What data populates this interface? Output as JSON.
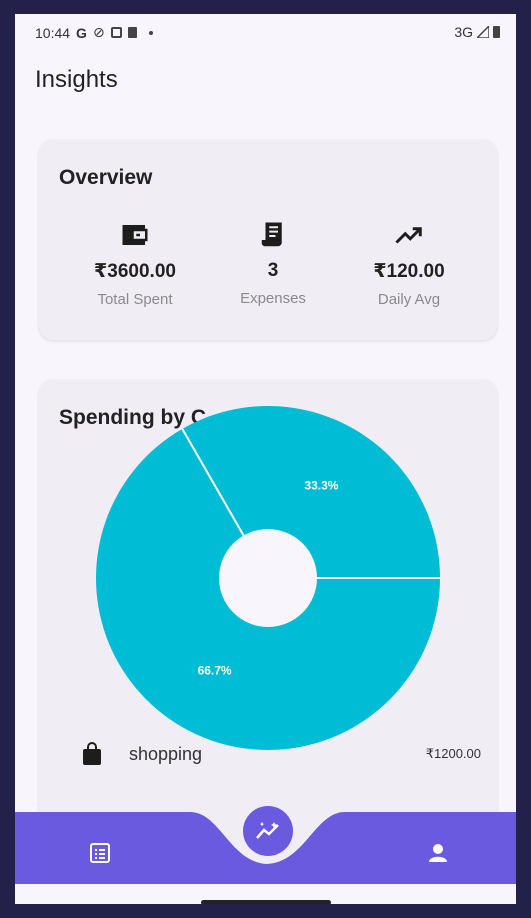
{
  "status": {
    "time": "10:44",
    "network": "3G"
  },
  "page_title": "Insights",
  "overview": {
    "title": "Overview",
    "stats": [
      {
        "icon": "wallet-icon",
        "value": "₹3600.00",
        "label": "Total Spent"
      },
      {
        "icon": "receipt-icon",
        "value": "3",
        "label": "Expenses"
      },
      {
        "icon": "trending-up-icon",
        "value": "₹120.00",
        "label": "Daily Avg"
      }
    ]
  },
  "spending": {
    "title": "Spending by C",
    "slices": [
      {
        "label": "66.7%",
        "value": 66.7
      },
      {
        "label": "33.3%",
        "value": 33.3
      }
    ],
    "legend": [
      {
        "icon": "shopping-bag-icon",
        "name": "shopping",
        "amount": "₹1200.00"
      }
    ]
  },
  "colors": {
    "accent": "#6a5adf",
    "slice": "#00bcd4"
  },
  "nav": {
    "items": [
      "list-icon",
      "insights-icon",
      "profile-icon"
    ]
  }
}
